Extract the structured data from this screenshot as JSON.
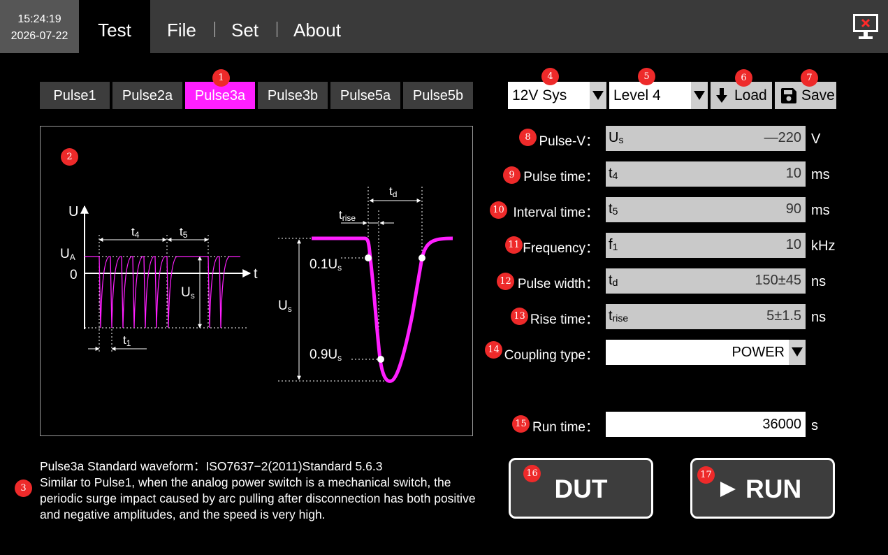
{
  "clock": {
    "time": "15:24:19",
    "date": "2026-07-22"
  },
  "menu": {
    "test": "Test",
    "file": "File",
    "set": "Set",
    "about": "About"
  },
  "badges": [
    "1",
    "2",
    "3",
    "4",
    "5",
    "6",
    "7",
    "8",
    "9",
    "10",
    "11",
    "12",
    "13",
    "14",
    "15",
    "16",
    "17"
  ],
  "pulse_tabs": [
    "Pulse1",
    "Pulse2a",
    "Pulse3a",
    "Pulse3b",
    "Pulse5a",
    "Pulse5b"
  ],
  "active_tab": "Pulse3a",
  "accent_color": "#ff1fff",
  "waveform": {
    "left": {
      "u": "U",
      "ua": "U",
      "ua_sub": "A",
      "zero": "0",
      "t": "t",
      "t4": "t",
      "t4_sub": "4",
      "t5": "t",
      "t5_sub": "5",
      "us": "U",
      "us_sub": "s",
      "t1": "t",
      "t1_sub": "1"
    },
    "right": {
      "td": "t",
      "td_sub": "d",
      "trise": "t",
      "trise_sub": "rise",
      "u01": "0.1U",
      "u01_sub": "s",
      "u09": "0.9U",
      "u09_sub": "s",
      "us": "U",
      "us_sub": "s"
    }
  },
  "description": {
    "title": "Pulse3a Standard waveform：ISO7637−2(2011)Standard 5.6.3",
    "body": "Similar to Pulse1, when the analog power switch is a mechanical switch, the periodic surge impact caused by arc pulling after disconnection has both positive and negative amplitudes, and the speed is very high."
  },
  "system_select": "12V Sys",
  "level_select": "Level 4",
  "load_label": "Load",
  "save_label": "Save",
  "params": [
    {
      "label": "Pulse-V：",
      "sym": "U",
      "sub": "s",
      "value": "—220",
      "unit": "V"
    },
    {
      "label": "Pulse time：",
      "sym": "t",
      "sub": "4",
      "value": "10",
      "unit": "ms"
    },
    {
      "label": "Interval time：",
      "sym": "t",
      "sub": "5",
      "value": "90",
      "unit": "ms"
    },
    {
      "label": "Frequency：",
      "sym": "f",
      "sub": "1",
      "value": "10",
      "unit": "kHz"
    },
    {
      "label": "Pulse width：",
      "sym": "t",
      "sub": "d",
      "value": "150±45",
      "unit": "ns"
    },
    {
      "label": "Rise time：",
      "sym": "t",
      "sub": "rise",
      "value": "5±1.5",
      "unit": "ns"
    }
  ],
  "coupling": {
    "label": "Coupling type：",
    "value": "POWER"
  },
  "run_time": {
    "label": "Run time：",
    "value": "36000",
    "unit": "s"
  },
  "dut_label": "DUT",
  "run_label": "RUN",
  "icons": {
    "exit": "exit-monitor-icon",
    "load": "down-arrow-icon",
    "save": "floppy-disk-icon",
    "play": "play-icon"
  }
}
